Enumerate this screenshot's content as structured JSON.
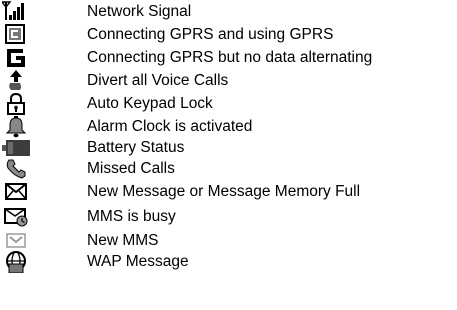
{
  "icon_list": {
    "items": [
      {
        "icon": "network-signal-icon",
        "label": "Network Signal"
      },
      {
        "icon": "gprs-connected-icon",
        "label": "Connecting GPRS and using GPRS"
      },
      {
        "icon": "gprs-no-data-icon",
        "label": "Connecting GPRS but no data alternating"
      },
      {
        "icon": "call-divert-icon",
        "label": "Divert all Voice Calls"
      },
      {
        "icon": "padlock-icon",
        "label": "Auto Keypad Lock"
      },
      {
        "icon": "alarm-bell-icon",
        "label": "Alarm Clock is activated"
      },
      {
        "icon": "battery-icon",
        "label": "Battery Status"
      },
      {
        "icon": "missed-call-icon",
        "label": "Missed Calls"
      },
      {
        "icon": "envelope-icon",
        "label": "New Message or Message Memory Full"
      },
      {
        "icon": "mms-busy-icon",
        "label": "MMS is busy"
      },
      {
        "icon": "new-mms-icon",
        "label": "New MMS"
      },
      {
        "icon": "wap-message-icon",
        "label": "WAP Message"
      }
    ]
  }
}
